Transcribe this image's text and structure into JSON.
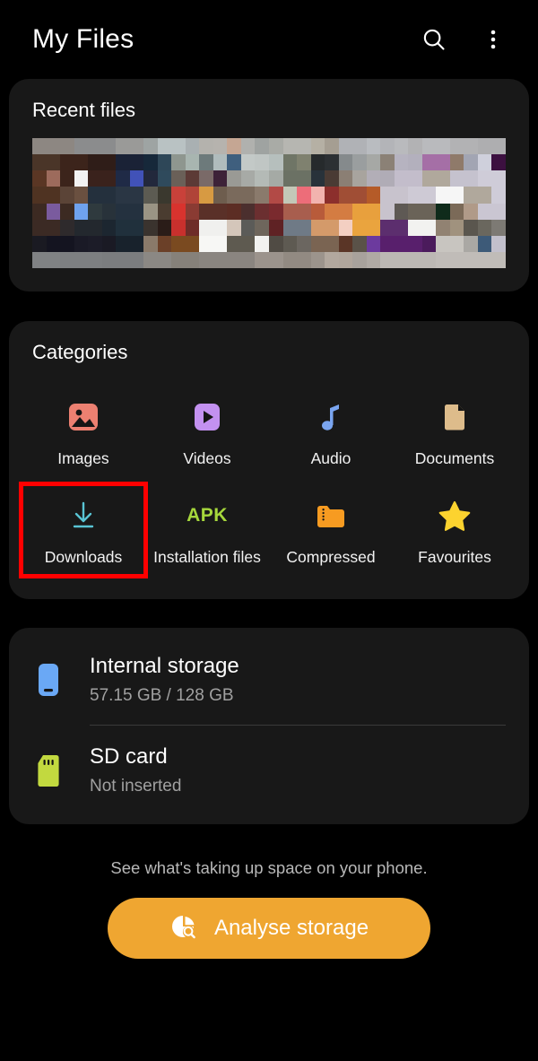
{
  "header": {
    "title": "My Files",
    "search_icon": "search-icon",
    "menu_icon": "more-vertical-icon"
  },
  "recent": {
    "title": "Recent files",
    "thumbnail_alt": "pixelated-recent-files-preview"
  },
  "categories": {
    "title": "Categories",
    "items": [
      {
        "label": "Images",
        "icon": "image-icon",
        "color": "#ec8071",
        "highlighted": false
      },
      {
        "label": "Videos",
        "icon": "video-play-icon",
        "color": "#c391f0",
        "highlighted": false
      },
      {
        "label": "Audio",
        "icon": "music-note-icon",
        "color": "#7aa5f0",
        "highlighted": false
      },
      {
        "label": "Documents",
        "icon": "document-icon",
        "color": "#ddbc8b",
        "highlighted": false
      },
      {
        "label": "Downloads",
        "icon": "download-icon",
        "color": "#59c4d4",
        "highlighted": true
      },
      {
        "label": "Installation files",
        "icon": "apk-icon",
        "color": "#a6d73c",
        "highlighted": false
      },
      {
        "label": "Compressed",
        "icon": "zip-folder-icon",
        "color": "#f79b21",
        "highlighted": false
      },
      {
        "label": "Favourites",
        "icon": "star-icon",
        "color": "#fcd32f",
        "highlighted": false
      }
    ],
    "apk_badge_text": "APK",
    "highlight_color": "#ff0000"
  },
  "storage": {
    "items": [
      {
        "name": "Internal storage",
        "detail": "57.15 GB / 128 GB",
        "icon": "phone-storage-icon",
        "color": "#6aa8f5"
      },
      {
        "name": "SD card",
        "detail": "Not inserted",
        "icon": "sd-card-icon",
        "color": "#c2d93f"
      }
    ]
  },
  "footer": {
    "hint": "See what's taking up space on your phone.",
    "button_label": "Analyse storage",
    "button_icon": "storage-analysis-icon",
    "button_color": "#efa631"
  },
  "thumbnail_pixels": [
    "#8d8782",
    "#8d8782",
    "#8d8782",
    "#8b8c8d",
    "#8b8c8d",
    "#8b8c8d",
    "#9a9a98",
    "#9a9a98",
    "#9ea4a3",
    "#b9c2c3",
    "#b9c2c3",
    "#a9b0b2",
    "#b4b2ad",
    "#b6b3ae",
    "#c5a693",
    "#b0b1ae",
    "#9fa3a1",
    "#a9aba6",
    "#b6b6b1",
    "#b6b6b1",
    "#b5b0a4",
    "#a59e92",
    "#b0b2b6",
    "#b0b2b6",
    "#b9bcc0",
    "#b3b4b8",
    "#b9babd",
    "#b2b2b4",
    "#b9babd",
    "#b9babd",
    "#b2b2b4",
    "#b2b2b4",
    "#aeaeb0",
    "#aeaeb0",
    "#4a3528",
    "#4a3528",
    "#3c241b",
    "#3c241b",
    "#2f1d18",
    "#2f1d18",
    "#1a2236",
    "#1a2236",
    "#16283a",
    "#2e4758",
    "#8e968f",
    "#a8b5b0",
    "#6d7a7b",
    "#b0bcbd",
    "#3f5f7e",
    "#c3c9c7",
    "#c0c6c4",
    "#b6bfbd",
    "#6f7566",
    "#7f816f",
    "#262a2c",
    "#2c3033",
    "#858a8c",
    "#9a9e9f",
    "#a6a8a5",
    "#8b8176",
    "#b6b3c0",
    "#b3b0bd",
    "#a56fa6",
    "#a56fa6",
    "#8f7a6a",
    "#a2a5b3",
    "#cfd0dc",
    "#3c1040",
    "#5a3624",
    "#9d6b5c",
    "#3c241b",
    "#f2f2f2",
    "#3a221c",
    "#3a221c",
    "#1f2a46",
    "#4152b8",
    "#22283c",
    "#2f4a5c",
    "#6a6058",
    "#5c3a36",
    "#7a6a68",
    "#3d2238",
    "#9a9a95",
    "#a7aaa6",
    "#b4bab6",
    "#a5aaa5",
    "#6b7164",
    "#6b7164",
    "#28323a",
    "#4a3b34",
    "#8b7f74",
    "#a8a49e",
    "#b2aeb7",
    "#b0acb6",
    "#c3bdcb",
    "#c3bdcb",
    "#b0a89c",
    "#b0a89c",
    "#c5c2ce",
    "#c5c2ce",
    "#cfccd8",
    "#cfccd8",
    "#4f3322",
    "#4f3322",
    "#5b4437",
    "#6a5040",
    "#24303d",
    "#24303d",
    "#2a3644",
    "#2a3644",
    "#5c5b52",
    "#3a382e",
    "#c9413a",
    "#b04438",
    "#d79a42",
    "#6e5d4e",
    "#7a6a5c",
    "#7a6a5c",
    "#8a7a6c",
    "#b24a46",
    "#c3c8b8",
    "#ed6d79",
    "#f2b3ae",
    "#8c2f2c",
    "#a04e35",
    "#a04e35",
    "#b55b28",
    "#c8c3cd",
    "#c8c3cd",
    "#cecad5",
    "#cecad5",
    "#f6f6f6",
    "#f6f6f6",
    "#b0a89c",
    "#b0a89c",
    "#cfccd8",
    "#3c2a22",
    "#7a5b9e",
    "#3c2a22",
    "#6fa2ee",
    "#2f3a3e",
    "#28323a",
    "#24313f",
    "#24313f",
    "#9a9484",
    "#4a3c30",
    "#d8332e",
    "#8a3b33",
    "#5a3028",
    "#5a3028",
    "#5c2d24",
    "#4b2f2e",
    "#6b2f30",
    "#7a2a2e",
    "#a85e4e",
    "#a85e4e",
    "#b85b3a",
    "#d47c42",
    "#d47c42",
    "#e8a03d",
    "#e8a03d",
    "#c8c3cd",
    "#5e5954",
    "#6a6358",
    "#6a6358",
    "#0f2b1b",
    "#7b6a58",
    "#b09a88",
    "#cac6d2",
    "#cac6d2",
    "#3b2a24",
    "#3b2a24",
    "#2e2a2c",
    "#23282e",
    "#23282e",
    "#1c2630",
    "#20303c",
    "#20303c",
    "#3a332e",
    "#2a1c18",
    "#c8302d",
    "#6e2c28",
    "#f0f0ee",
    "#f0f0ee",
    "#d4c6ba",
    "#5b5b58",
    "#6e665c",
    "#5f2224",
    "#6f7a86",
    "#6f7a86",
    "#d49a6a",
    "#d49a6a",
    "#f3cfc2",
    "#eaa43e",
    "#eaa43e",
    "#5c2e6e",
    "#5c2e6e",
    "#f2f2f0",
    "#f2f2f0",
    "#918272",
    "#a0927e",
    "#5a564e",
    "#6a675e",
    "#7d7a74",
    "#1a1a22",
    "#141420",
    "#141420",
    "#1a1a26",
    "#1c1c28",
    "#1a1a24",
    "#18222c",
    "#18222c",
    "#8a7a6a",
    "#6b4028",
    "#7a4a20",
    "#7a4a20",
    "#f7f7f5",
    "#f7f7f5",
    "#5e5a50",
    "#5e5a50",
    "#f2f2f0",
    "#504b44",
    "#5e5a52",
    "#6b6660",
    "#7a6452",
    "#7a6452",
    "#5a3526",
    "#5a5248",
    "#6c3a9e",
    "#581f6c",
    "#581f6c",
    "#581f6c",
    "#4b1b5c",
    "#c8c5c0",
    "#c8c5c0",
    "#aaa8a4",
    "#3d5a78",
    "#c2c0cc",
    "#808284",
    "#808284",
    "#7d7f81",
    "#7d7f81",
    "#7d7f81",
    "#7b7d7f",
    "#7b7d7f",
    "#7b7d7f",
    "#8b8884",
    "#8b8884",
    "#86817a",
    "#86817a",
    "#8a8580",
    "#8a8580",
    "#8a8580",
    "#8a8580",
    "#9b938c",
    "#9b938c",
    "#928a82",
    "#928a82",
    "#9c948c",
    "#b2a89e",
    "#b0a69c",
    "#a8a29c",
    "#b0aaa4",
    "#bcb8b4",
    "#bcb8b4",
    "#bcb8b4",
    "#bcb8b4",
    "#c0bcb8",
    "#c0bcb8",
    "#c0bcb8",
    "#c0bcb8",
    "#c0bcb8"
  ]
}
